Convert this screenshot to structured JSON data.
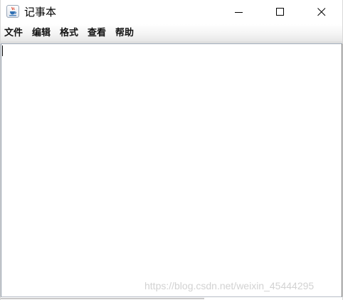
{
  "window": {
    "title": "记事本",
    "icon": "java-cup-icon",
    "controls": [
      "minimize-icon",
      "maximize-icon",
      "close-icon"
    ]
  },
  "menubar": {
    "items": [
      {
        "label": "文件"
      },
      {
        "label": "编辑"
      },
      {
        "label": "格式"
      },
      {
        "label": "查看"
      },
      {
        "label": "帮助"
      }
    ]
  },
  "editor": {
    "text": ""
  },
  "watermark": {
    "text": "https://blog.csdn.net/weixin_45444295"
  },
  "colors": {
    "menubar_top": "#ffffff",
    "menubar_bottom": "#e6e6e6",
    "border": "#8f9aa8",
    "watermark": "#d2d2d2"
  }
}
